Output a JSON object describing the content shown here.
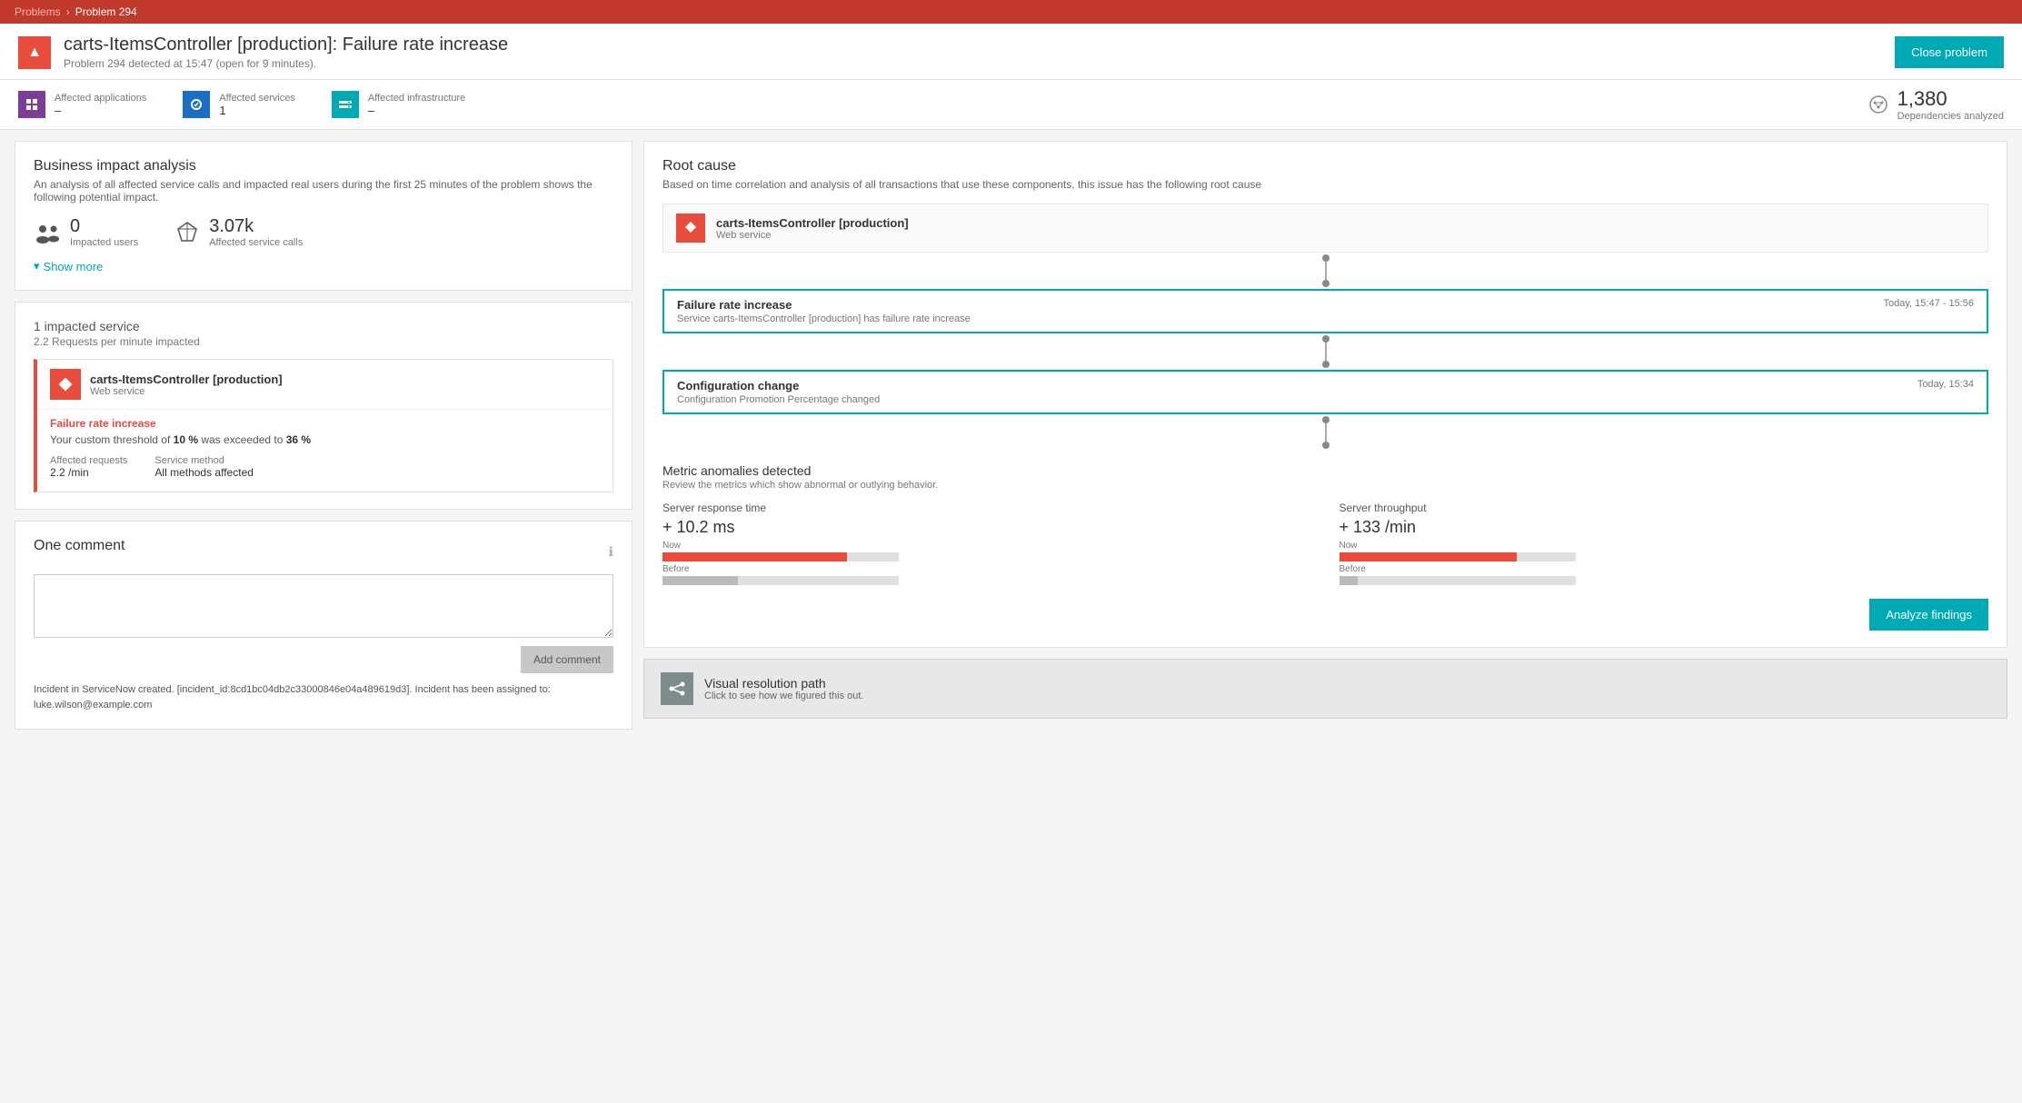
{
  "breadcrumb": {
    "problems": "Problems",
    "separator": "›",
    "current": "Problem 294"
  },
  "header": {
    "title": "carts-ItemsController [production]: Failure rate increase",
    "subtitle": "Problem 294 detected at 15:47 (open for 9 minutes).",
    "close_button": "Close problem",
    "warning_icon": "warning-triangle-icon"
  },
  "affected_bar": {
    "applications": {
      "label": "Affected applications",
      "value": "–",
      "icon": "applications-icon"
    },
    "services": {
      "label": "Affected services",
      "value": "1",
      "icon": "services-icon"
    },
    "infrastructure": {
      "label": "Affected infrastructure",
      "value": "–",
      "icon": "infrastructure-icon"
    },
    "dependencies": {
      "label": "Dependencies analyzed",
      "count": "1,380",
      "icon": "dependencies-icon"
    }
  },
  "business_impact": {
    "title": "Business impact analysis",
    "subtitle": "An analysis of all affected service calls and impacted real users during the first 25 minutes of the problem shows the following potential impact.",
    "impacted_users": {
      "value": "0",
      "label": "Impacted users",
      "icon": "users-icon"
    },
    "affected_service_calls": {
      "value": "3.07k",
      "label": "Affected service calls",
      "icon": "service-calls-icon"
    },
    "show_more": "Show more"
  },
  "impacted_service": {
    "title": "1 impacted service",
    "subtitle": "2.2 Requests per minute impacted",
    "service_name": "carts-ItemsController [production]",
    "service_type": "Web service",
    "failure_rate_label": "Failure rate increase",
    "threshold_text": "Your custom threshold of ",
    "threshold_bold": "10 %",
    "threshold_text2": " was exceeded to ",
    "threshold_bold2": "36 %",
    "affected_requests_label": "Affected requests",
    "affected_requests_value": "2.2 /min",
    "service_method_label": "Service method",
    "service_method_value": "All methods affected"
  },
  "comment": {
    "title": "One comment",
    "placeholder": "",
    "add_button": "Add comment",
    "incident_note": "Incident in ServiceNow created. [incident_id:8cd1bc04db2c33000846e04a489619d3]. Incident has been assigned to: luke.wilson@example.com"
  },
  "root_cause": {
    "title": "Root cause",
    "subtitle": "Based on time correlation and analysis of all transactions that use these components, this issue has the following root cause",
    "service_name": "carts-ItemsController [production]",
    "service_type": "Web service",
    "failure_rate": {
      "title": "Failure rate increase",
      "time": "Today, 15:47 - 15:56",
      "description": "Service carts-ItemsController [production] has failure rate increase"
    },
    "config_change": {
      "title": "Configuration change",
      "time": "Today, 15:34",
      "description": "Configuration Promotion Percentage changed"
    },
    "anomalies": {
      "title": "Metric anomalies detected",
      "subtitle": "Review the metrics which show abnormal or outlying behavior.",
      "server_response": {
        "title": "Server response time",
        "delta": "+ 10.2 ms",
        "now_label": "Now",
        "before_label": "Before",
        "now_bar_width": "78",
        "before_bar_width": "32"
      },
      "server_throughput": {
        "title": "Server throughput",
        "delta": "+ 133 /min",
        "now_label": "Now",
        "before_label": "Before",
        "now_bar_width": "75",
        "before_bar_width": "8"
      }
    },
    "analyze_button": "Analyze findings"
  },
  "visual_resolution": {
    "title": "Visual resolution path",
    "subtitle": "Click to see how we figured this out.",
    "icon": "resolution-path-icon"
  }
}
